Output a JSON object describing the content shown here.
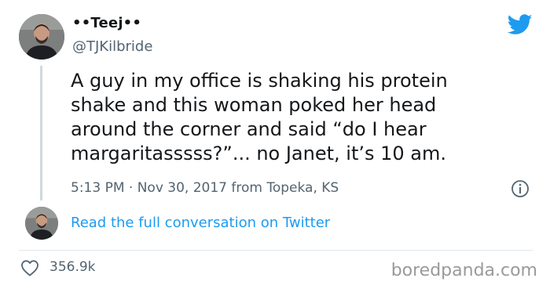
{
  "tweet": {
    "display_name": "••Teej••",
    "handle": "@TJKilbride",
    "text": "A guy in my office is shaking his protein\nshake and this woman poked her head\naround the corner and said “do I hear\nmargaritasssss?”... no Janet, it’s 10 am.",
    "meta": "5:13 PM · Nov 30, 2017 from Topeka, KS",
    "read_link": "Read the full conversation on Twitter",
    "likes": "356.9k"
  },
  "icons": {
    "brand": "twitter-bird-icon",
    "info": "info-icon",
    "like": "heart-icon"
  },
  "watermark": "boredpanda.com",
  "colors": {
    "brand": "#1d9bf0",
    "text": "#14171a",
    "muted": "#536471"
  }
}
